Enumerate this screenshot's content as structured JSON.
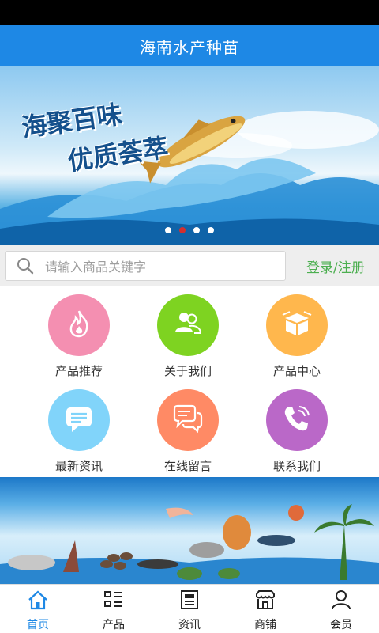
{
  "app": {
    "title": "海南水产种苗"
  },
  "banner": {
    "line1": "海聚百味",
    "line2": "优质荟萃",
    "slide_count": 4,
    "active_slide": 2
  },
  "search": {
    "placeholder": "请输入商品关键字",
    "icon": "search-icon"
  },
  "auth": {
    "login_register": "登录/注册"
  },
  "menu": [
    {
      "label": "产品推荐",
      "icon": "flame-icon",
      "color": "#f48fb1"
    },
    {
      "label": "关于我们",
      "icon": "users-icon",
      "color": "#7ed321"
    },
    {
      "label": "产品中心",
      "icon": "box-icon",
      "color": "#ffb74d"
    },
    {
      "label": "最新资讯",
      "icon": "message-icon",
      "color": "#81d4fa"
    },
    {
      "label": "在线留言",
      "icon": "chat-icon",
      "color": "#ff8a65"
    },
    {
      "label": "联系我们",
      "icon": "phone-icon",
      "color": "#ba68c8"
    }
  ],
  "tabs": [
    {
      "label": "首页",
      "icon": "home-icon",
      "active": true
    },
    {
      "label": "产品",
      "icon": "grid-list-icon",
      "active": false
    },
    {
      "label": "资讯",
      "icon": "news-icon",
      "active": false
    },
    {
      "label": "商铺",
      "icon": "store-icon",
      "active": false
    },
    {
      "label": "会员",
      "icon": "user-icon",
      "active": false
    }
  ],
  "colors": {
    "primary": "#1e88e5",
    "accent_green": "#4caf50",
    "active_dot": "#d32f2f"
  }
}
